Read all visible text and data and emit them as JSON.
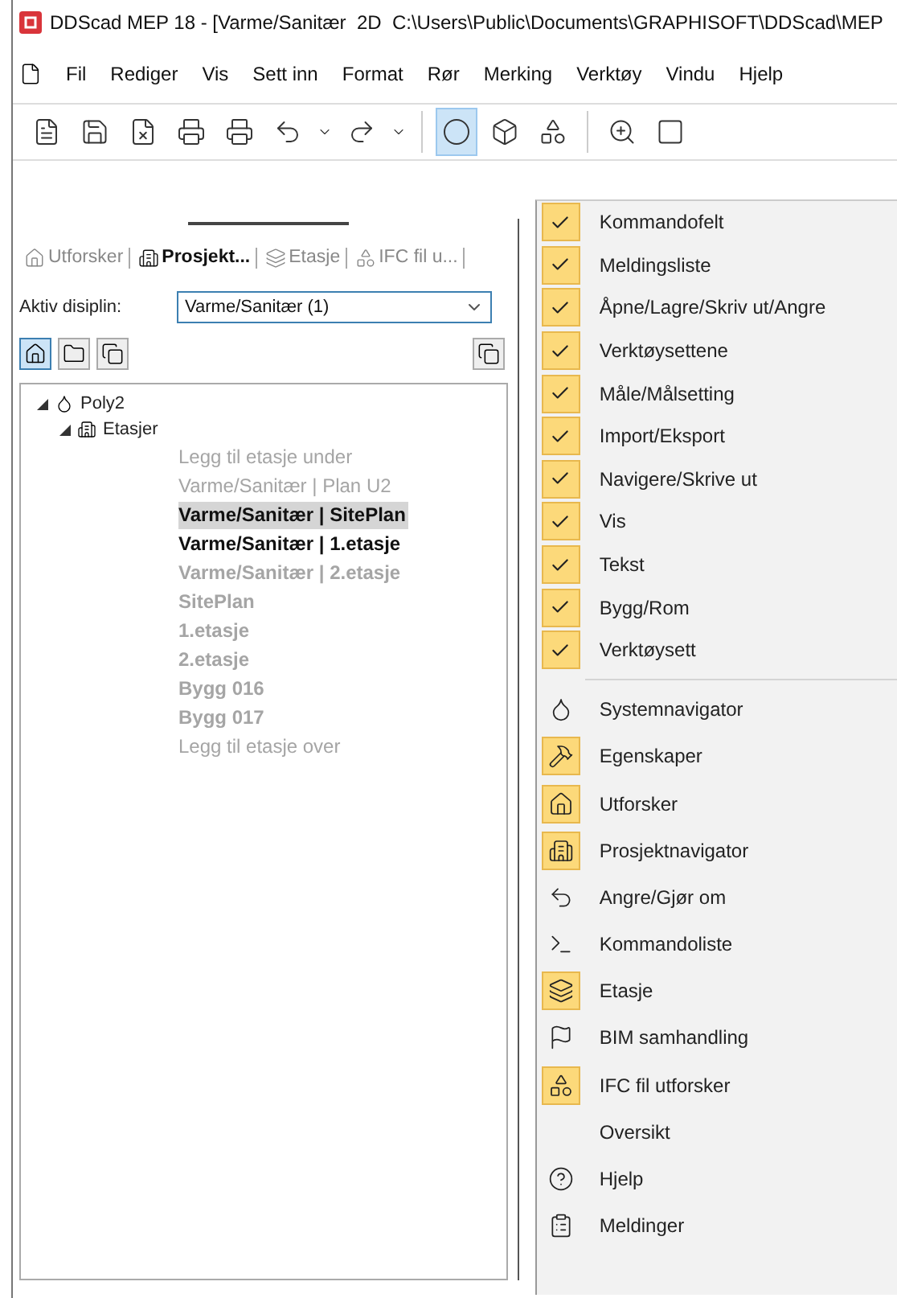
{
  "window": {
    "title": "DDScad MEP 18 - [Varme/Sanitær  2D  C:\\Users\\Public\\Documents\\GRAPHISOFT\\DDScad\\MEP"
  },
  "menu_bar": [
    "Fil",
    "Rediger",
    "Vis",
    "Sett inn",
    "Format",
    "Rør",
    "Merking",
    "Verktøy",
    "Vindu",
    "Hjelp"
  ],
  "toolbar": [
    {
      "selected": false
    },
    {
      "selected": false
    },
    {
      "selected": false
    },
    {
      "selected": false
    },
    {
      "selected": false
    },
    {
      "selected": false
    },
    {
      "selected": false
    },
    {
      "selected": false
    },
    {
      "selected": false
    },
    {
      "selected": true
    },
    {
      "selected": false
    },
    {
      "selected": false
    },
    {
      "selected": false
    },
    {
      "selected": false
    }
  ],
  "panel": {
    "tabs": [
      {
        "label": "Utforsker",
        "selected": false
      },
      {
        "label": "Prosjekt...",
        "selected": true
      },
      {
        "label": "Etasje",
        "selected": false
      },
      {
        "label": "IFC fil u...",
        "selected": false
      }
    ],
    "discipline_label": "Aktiv disiplin:",
    "discipline_value": "Varme/Sanitær (1)",
    "view_buttons": [
      {
        "selected": true
      },
      {
        "selected": false
      },
      {
        "selected": false
      }
    ],
    "tree": [
      {
        "label": "Poly2",
        "expanded": true,
        "children": [
          {
            "label": "Etasjer",
            "expanded": true,
            "children": [
              {
                "label": "Legg til etasje under",
                "bold": false,
                "active": false,
                "selected": false
              },
              {
                "label": "Varme/Sanitær | Plan U2",
                "bold": false,
                "active": false,
                "selected": false
              },
              {
                "label": "Varme/Sanitær | SitePlan",
                "bold": true,
                "active": true,
                "selected": true
              },
              {
                "label": "Varme/Sanitær | 1.etasje",
                "bold": true,
                "active": true,
                "selected": false
              },
              {
                "label": "Varme/Sanitær | 2.etasje",
                "bold": true,
                "active": false,
                "selected": false
              },
              {
                "label": "SitePlan",
                "bold": true,
                "active": false,
                "selected": false
              },
              {
                "label": "1.etasje",
                "bold": true,
                "active": false,
                "selected": false
              },
              {
                "label": "2.etasje",
                "bold": true,
                "active": false,
                "selected": false
              },
              {
                "label": "Bygg 016",
                "bold": true,
                "active": false,
                "selected": false
              },
              {
                "label": "Bygg 017",
                "bold": true,
                "active": false,
                "selected": false
              },
              {
                "label": "Legg til etasje over",
                "bold": false,
                "active": false,
                "selected": false
              }
            ]
          }
        ]
      }
    ]
  },
  "context_menu": [
    {
      "kind": "check",
      "label": "Kommandofelt",
      "checked": true
    },
    {
      "kind": "check",
      "label": "Meldingsliste",
      "checked": true
    },
    {
      "kind": "check",
      "label": "Åpne/Lagre/Skriv ut/Angre",
      "checked": true
    },
    {
      "kind": "check",
      "label": "Verktøysettene",
      "checked": true
    },
    {
      "kind": "check",
      "label": "Måle/Målsetting",
      "checked": true
    },
    {
      "kind": "check",
      "label": "Import/Eksport",
      "checked": true
    },
    {
      "kind": "check",
      "label": "Navigere/Skrive ut",
      "checked": true
    },
    {
      "kind": "check",
      "label": "Vis",
      "checked": true
    },
    {
      "kind": "check",
      "label": "Tekst",
      "checked": true
    },
    {
      "kind": "check",
      "label": "Bygg/Rom",
      "checked": true
    },
    {
      "kind": "check",
      "label": "Verktøysett",
      "checked": true
    },
    {
      "kind": "tool",
      "label": "Systemnavigator",
      "checked": false
    },
    {
      "kind": "tool",
      "label": "Egenskaper",
      "checked": true
    },
    {
      "kind": "tool",
      "label": "Utforsker",
      "checked": true
    },
    {
      "kind": "tool",
      "label": "Prosjektnavigator",
      "checked": true
    },
    {
      "kind": "tool",
      "label": "Angre/Gjør om",
      "checked": false
    },
    {
      "kind": "tool",
      "label": "Kommandoliste",
      "checked": false
    },
    {
      "kind": "tool",
      "label": "Etasje",
      "checked": true
    },
    {
      "kind": "tool",
      "label": "BIM samhandling",
      "checked": false
    },
    {
      "kind": "tool",
      "label": "IFC fil utforsker",
      "checked": true
    },
    {
      "kind": "tool",
      "label": "Oversikt",
      "checked": false
    },
    {
      "kind": "tool",
      "label": "Hjelp",
      "checked": false
    },
    {
      "kind": "tool",
      "label": "Meldinger",
      "checked": false
    }
  ]
}
